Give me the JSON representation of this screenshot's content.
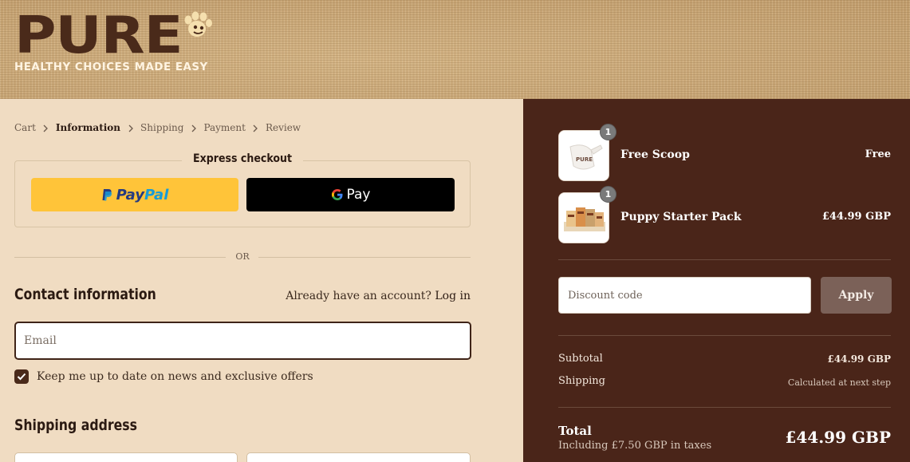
{
  "brand": {
    "wordmark": "PURE",
    "tagline": "HEALTHY CHOICES MADE EASY"
  },
  "breadcrumb": [
    "Cart",
    "Information",
    "Shipping",
    "Payment",
    "Review"
  ],
  "express_checkout": {
    "title": "Express checkout",
    "paypal_label_1": "Pay",
    "paypal_label_2": "Pal",
    "gpay_label": "Pay"
  },
  "divider_text": "OR",
  "contact": {
    "title": "Contact information",
    "account_prompt": "Already have an account?",
    "login_label": "Log in",
    "email_placeholder": "Email",
    "newsletter_label": "Keep me up to date on news and exclusive offers",
    "newsletter_checked": true
  },
  "shipping_address": {
    "title": "Shipping address"
  },
  "cart": {
    "items": [
      {
        "name": "Free Scoop",
        "price": "Free",
        "quantity": "1"
      },
      {
        "name": "Puppy Starter Pack",
        "price": "£44.99 GBP",
        "quantity": "1"
      }
    ]
  },
  "discount": {
    "placeholder": "Discount code",
    "apply_label": "Apply"
  },
  "totals": {
    "subtotal_label": "Subtotal",
    "subtotal_value": "£44.99 GBP",
    "shipping_label": "Shipping",
    "shipping_value": "Calculated at next step",
    "total_label": "Total",
    "tax_note": "Including £7.50 GBP in taxes",
    "total_value": "£44.99 GBP"
  },
  "colors": {
    "summary_bg": "#4a2519",
    "main_bg": "#f0dcc2",
    "paypal_yellow": "#ffc439",
    "brand_brown": "#4a2a1a"
  }
}
